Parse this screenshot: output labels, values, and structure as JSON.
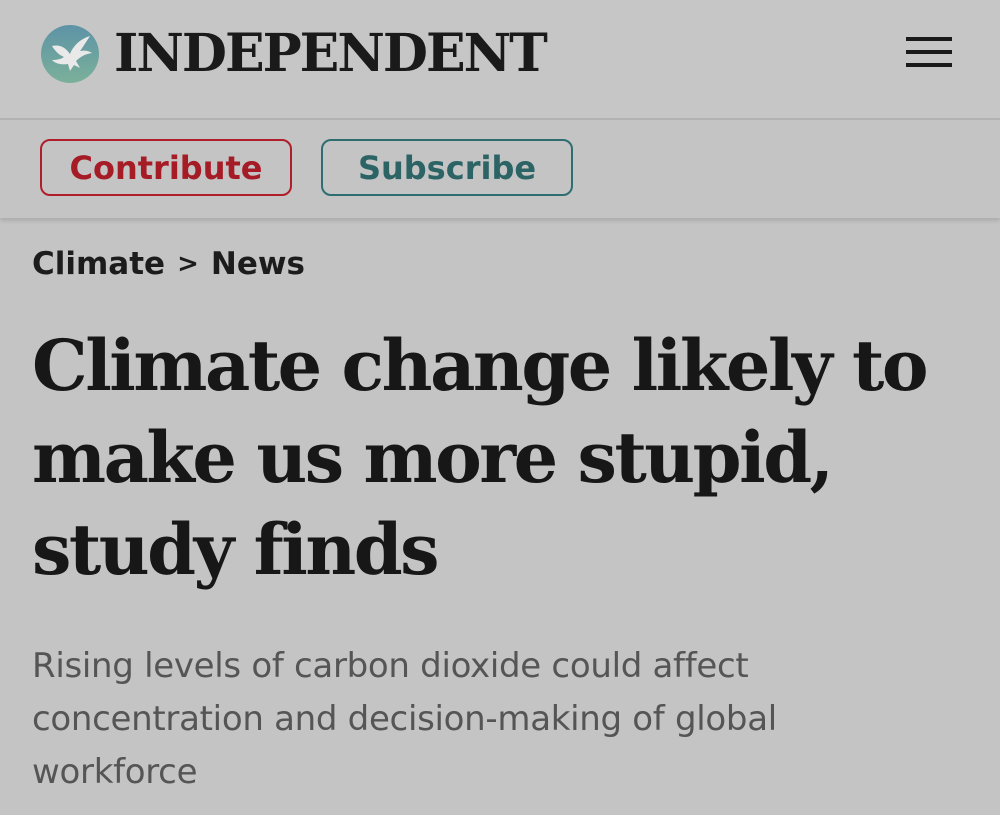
{
  "header": {
    "logo_icon": "eagle-icon",
    "wordmark": "INDEPENDENT",
    "menu_icon": "hamburger-menu-icon"
  },
  "actions": {
    "contribute_label": "Contribute",
    "subscribe_label": "Subscribe",
    "colors": {
      "contribute": "#a51b26",
      "subscribe": "#2c6466"
    }
  },
  "breadcrumb": {
    "section": "Climate",
    "separator": ">",
    "subsection": "News"
  },
  "article": {
    "headline": "Climate change likely to make us more stupid, study finds",
    "standfirst": "Rising levels of carbon dioxide could affect concentration and decision-making of global workforce"
  }
}
